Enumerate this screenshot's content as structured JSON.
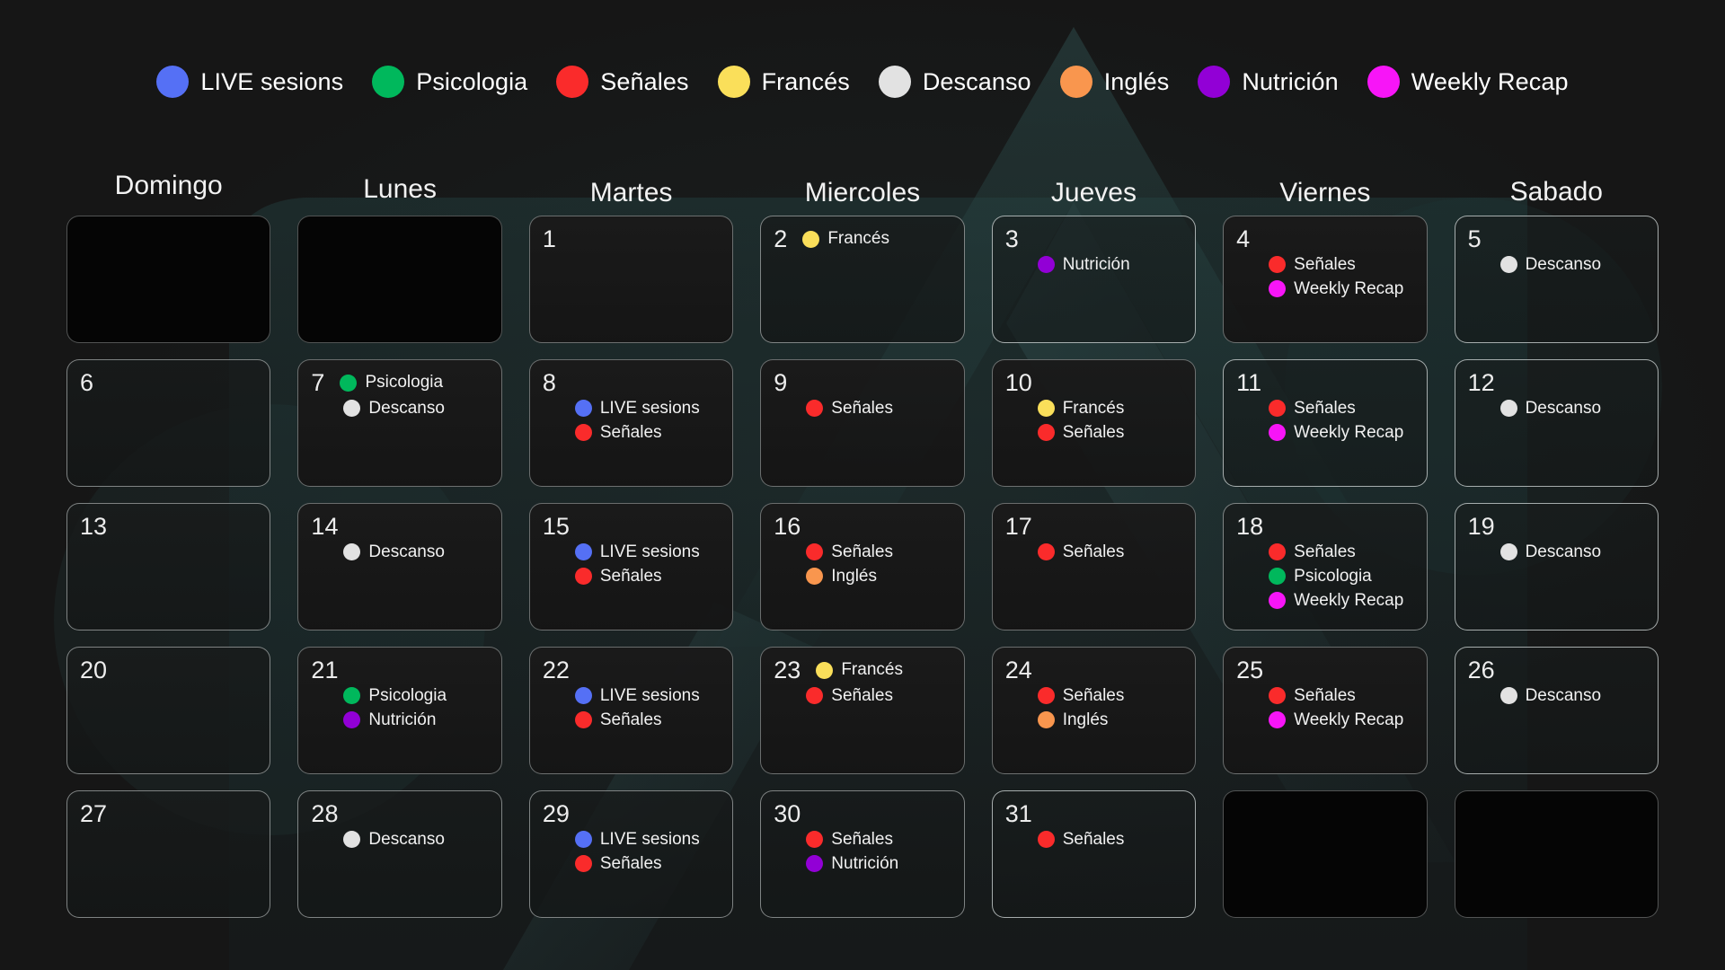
{
  "legend": {
    "items": [
      {
        "label": "LIVE sesions",
        "color": "#5570f5"
      },
      {
        "label": "Psicologia",
        "color": "#00b85c"
      },
      {
        "label": "Señales",
        "color": "#fa2b2b"
      },
      {
        "label": "Francés",
        "color": "#fadf5a"
      },
      {
        "label": "Descanso",
        "color": "#e2e2e2"
      },
      {
        "label": "Inglés",
        "color": "#f9964e"
      },
      {
        "label": "Nutrición",
        "color": "#9200d6"
      },
      {
        "label": "Weekly Recap",
        "color": "#f715f7"
      }
    ]
  },
  "calendar": {
    "weekdays": [
      "Domingo",
      "Lunes",
      "Martes",
      "Miercoles",
      "Jueves",
      "Viernes",
      "Sabado"
    ],
    "weeks": [
      [
        {
          "day": "",
          "events": []
        },
        {
          "day": "",
          "events": []
        },
        {
          "day": "1",
          "events": []
        },
        {
          "day": "2",
          "inline": true,
          "events": [
            {
              "label": "Francés",
              "color": "#fadf5a"
            }
          ]
        },
        {
          "day": "3",
          "events": [
            {
              "label": "Nutrición",
              "color": "#9200d6"
            }
          ]
        },
        {
          "day": "4",
          "events": [
            {
              "label": "Señales",
              "color": "#fa2b2b"
            },
            {
              "label": "Weekly Recap",
              "color": "#f715f7"
            }
          ]
        },
        {
          "day": "5",
          "events": [
            {
              "label": "Descanso",
              "color": "#e2e2e2"
            }
          ]
        }
      ],
      [
        {
          "day": "6",
          "events": []
        },
        {
          "day": "7",
          "inline": true,
          "events": [
            {
              "label": "Psicologia",
              "color": "#00b85c"
            },
            {
              "label": "Descanso",
              "color": "#e2e2e2"
            }
          ]
        },
        {
          "day": "8",
          "events": [
            {
              "label": "LIVE sesions",
              "color": "#5570f5"
            },
            {
              "label": "Señales",
              "color": "#fa2b2b"
            }
          ]
        },
        {
          "day": "9",
          "events": [
            {
              "label": "Señales",
              "color": "#fa2b2b"
            }
          ]
        },
        {
          "day": "10",
          "events": [
            {
              "label": "Francés",
              "color": "#fadf5a"
            },
            {
              "label": "Señales",
              "color": "#fa2b2b"
            }
          ]
        },
        {
          "day": "11",
          "events": [
            {
              "label": "Señales",
              "color": "#fa2b2b"
            },
            {
              "label": "Weekly Recap",
              "color": "#f715f7"
            }
          ]
        },
        {
          "day": "12",
          "events": [
            {
              "label": "Descanso",
              "color": "#e2e2e2"
            }
          ]
        }
      ],
      [
        {
          "day": "13",
          "events": []
        },
        {
          "day": "14",
          "events": [
            {
              "label": "Descanso",
              "color": "#e2e2e2"
            }
          ]
        },
        {
          "day": "15",
          "events": [
            {
              "label": "LIVE sesions",
              "color": "#5570f5"
            },
            {
              "label": "Señales",
              "color": "#fa2b2b"
            }
          ]
        },
        {
          "day": "16",
          "events": [
            {
              "label": "Señales",
              "color": "#fa2b2b"
            },
            {
              "label": "Inglés",
              "color": "#f9964e"
            }
          ]
        },
        {
          "day": "17",
          "events": [
            {
              "label": "Señales",
              "color": "#fa2b2b"
            }
          ]
        },
        {
          "day": "18",
          "events": [
            {
              "label": "Señales",
              "color": "#fa2b2b"
            },
            {
              "label": "Psicologia",
              "color": "#00b85c"
            },
            {
              "label": "Weekly Recap",
              "color": "#f715f7"
            }
          ]
        },
        {
          "day": "19",
          "events": [
            {
              "label": "Descanso",
              "color": "#e2e2e2"
            }
          ]
        }
      ],
      [
        {
          "day": "20",
          "events": []
        },
        {
          "day": "21",
          "events": [
            {
              "label": "Psicologia",
              "color": "#00b85c"
            },
            {
              "label": "Nutrición",
              "color": "#9200d6"
            }
          ]
        },
        {
          "day": "22",
          "events": [
            {
              "label": "LIVE sesions",
              "color": "#5570f5"
            },
            {
              "label": "Señales",
              "color": "#fa2b2b"
            }
          ]
        },
        {
          "day": "23",
          "inline": true,
          "events": [
            {
              "label": "Francés",
              "color": "#fadf5a"
            },
            {
              "label": "Señales",
              "color": "#fa2b2b"
            }
          ]
        },
        {
          "day": "24",
          "events": [
            {
              "label": "Señales",
              "color": "#fa2b2b"
            },
            {
              "label": "Inglés",
              "color": "#f9964e"
            }
          ]
        },
        {
          "day": "25",
          "events": [
            {
              "label": "Señales",
              "color": "#fa2b2b"
            },
            {
              "label": "Weekly Recap",
              "color": "#f715f7"
            }
          ]
        },
        {
          "day": "26",
          "events": [
            {
              "label": "Descanso",
              "color": "#e2e2e2"
            }
          ]
        }
      ],
      [
        {
          "day": "27",
          "events": []
        },
        {
          "day": "28",
          "events": [
            {
              "label": "Descanso",
              "color": "#e2e2e2"
            }
          ]
        },
        {
          "day": "29",
          "events": [
            {
              "label": "LIVE sesions",
              "color": "#5570f5"
            },
            {
              "label": "Señales",
              "color": "#fa2b2b"
            }
          ]
        },
        {
          "day": "30",
          "events": [
            {
              "label": "Señales",
              "color": "#fa2b2b"
            },
            {
              "label": "Nutrición",
              "color": "#9200d6"
            }
          ]
        },
        {
          "day": "31",
          "events": [
            {
              "label": "Señales",
              "color": "#fa2b2b"
            }
          ]
        },
        {
          "day": "",
          "events": []
        },
        {
          "day": "",
          "events": []
        }
      ]
    ]
  }
}
